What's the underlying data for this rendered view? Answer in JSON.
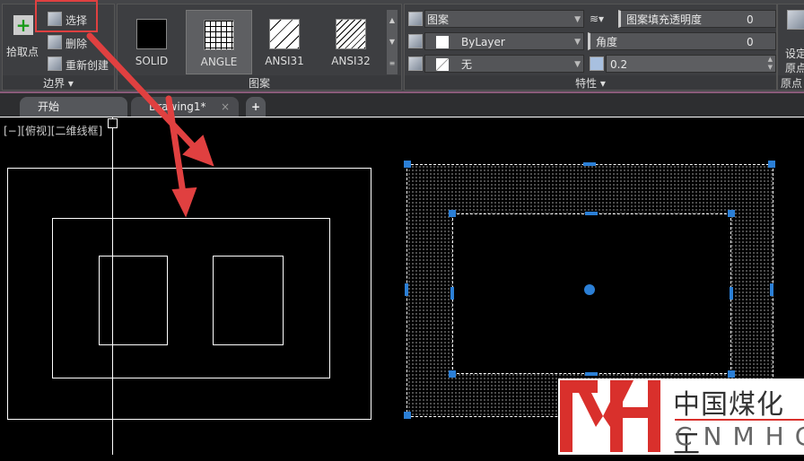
{
  "ribbon": {
    "boundary": {
      "pick_points": "拾取点",
      "select": "选择",
      "remove": "删除",
      "recreate": "重新创建",
      "label": "边界 ▾"
    },
    "pattern": {
      "items": [
        "SOLID",
        "ANGLE",
        "ANSI31",
        "ANSI32"
      ],
      "selected": "ANGLE",
      "label": "图案"
    },
    "properties": {
      "type": "图案",
      "color": "ByLayer",
      "background": "无",
      "transparency_label": "图案填充透明度",
      "transparency": "0",
      "angle_label": "角度",
      "angle": "0",
      "scale": "0.2",
      "label": "特性 ▾"
    },
    "origin": {
      "set_line1": "设定",
      "set_line2": "原点",
      "label": "原点"
    }
  },
  "tabs": [
    {
      "label": "开始"
    },
    {
      "label": "Drawing1*"
    }
  ],
  "viewport": {
    "label": "[−][俯视][二维线框]"
  },
  "watermark": {
    "logo": "MH",
    "cn": "中国煤化工",
    "en": "CNMHG"
  },
  "colors": {
    "highlight": "#e04040",
    "grip": "#2b7fd6"
  }
}
